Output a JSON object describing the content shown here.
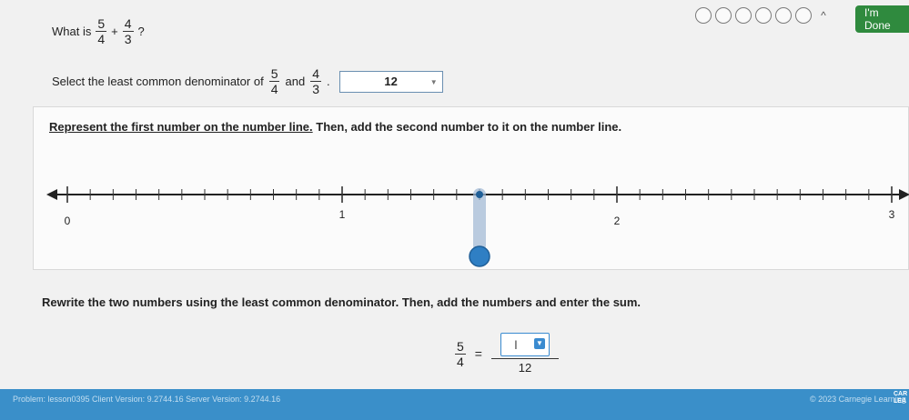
{
  "question": {
    "prefix": "What is",
    "a_num": "5",
    "a_den": "4",
    "op": "+",
    "b_num": "4",
    "b_den": "3",
    "suffix": "?"
  },
  "progress": {
    "circles": 6,
    "caret": "^"
  },
  "done_button": "I'm Done",
  "lcd": {
    "prefix": "Select the least common denominator of",
    "a_num": "5",
    "a_den": "4",
    "and": "and",
    "b_num": "4",
    "b_den": "3",
    "suffix": ".",
    "selected": "12"
  },
  "numberline_panel": {
    "instruction_link": "Represent the first number on the number line.",
    "instruction_rest": " Then, add the second number to it on the number line.",
    "min": 0,
    "max": 3,
    "divisions_per_unit": 12,
    "labels": [
      "0",
      "1",
      "2",
      "3"
    ],
    "marker_value": 1.5,
    "accent": "#2f7fc4"
  },
  "rewrite": "Rewrite the two numbers using the least common denominator. Then, add the numbers and enter the sum.",
  "equation": {
    "num": "5",
    "den": "4",
    "eq": "=",
    "sum_den": "12",
    "cursor": "I"
  },
  "footer": {
    "left": "Problem: lesson0395  Client Version: 9.2744.16  Server Version: 9.2744.16",
    "right": "© 2023 Carnegie Learning",
    "logo_top": "CAR",
    "logo_bottom": "LEA"
  }
}
